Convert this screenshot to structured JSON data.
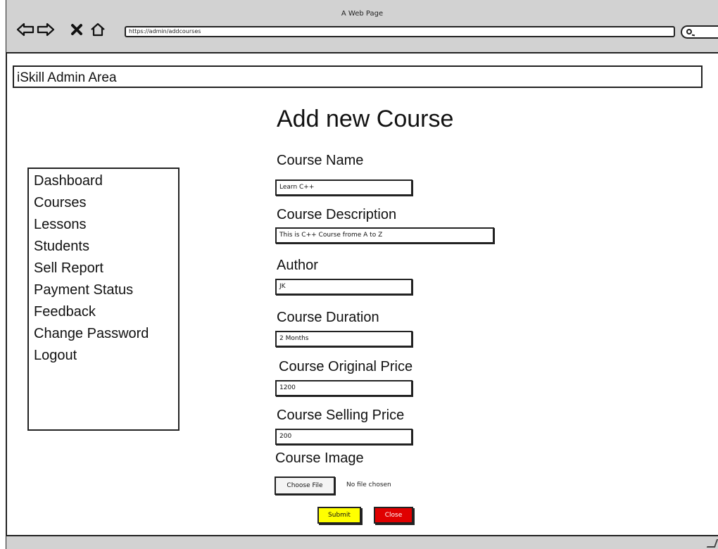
{
  "window": {
    "title": "A Web Page",
    "url": "https://admin/addcourses"
  },
  "header": {
    "title": "iSkill Admin Area"
  },
  "sidebar": {
    "items": [
      {
        "label": "Dashboard"
      },
      {
        "label": "Courses"
      },
      {
        "label": "Lessons"
      },
      {
        "label": "Students"
      },
      {
        "label": "Sell Report"
      },
      {
        "label": "Payment Status"
      },
      {
        "label": "Feedback"
      },
      {
        "label": "Change Password"
      },
      {
        "label": "Logout"
      }
    ]
  },
  "form": {
    "title": "Add new Course",
    "course_name": {
      "label": "Course Name",
      "value": "Learn C++"
    },
    "course_description": {
      "label": "Course Description",
      "value": "This is C++ Course frome A to Z"
    },
    "author": {
      "label": "Author",
      "value": "JK"
    },
    "course_duration": {
      "label": "Course Duration",
      "value": "2 Months"
    },
    "original_price": {
      "label": "Course Original Price",
      "value": "1200"
    },
    "selling_price": {
      "label": "Course Selling Price",
      "value": "200"
    },
    "course_image": {
      "label": "Course Image",
      "button": "Choose File",
      "status": "No file chosen"
    },
    "submit_label": "Submit",
    "close_label": "Close"
  },
  "icons": [
    "back-arrow-icon",
    "forward-arrow-icon",
    "stop-icon",
    "home-icon",
    "search-icon"
  ],
  "colors": {
    "chrome": "#d2d2d2",
    "submit": "#ffff00",
    "close": "#e00000"
  }
}
